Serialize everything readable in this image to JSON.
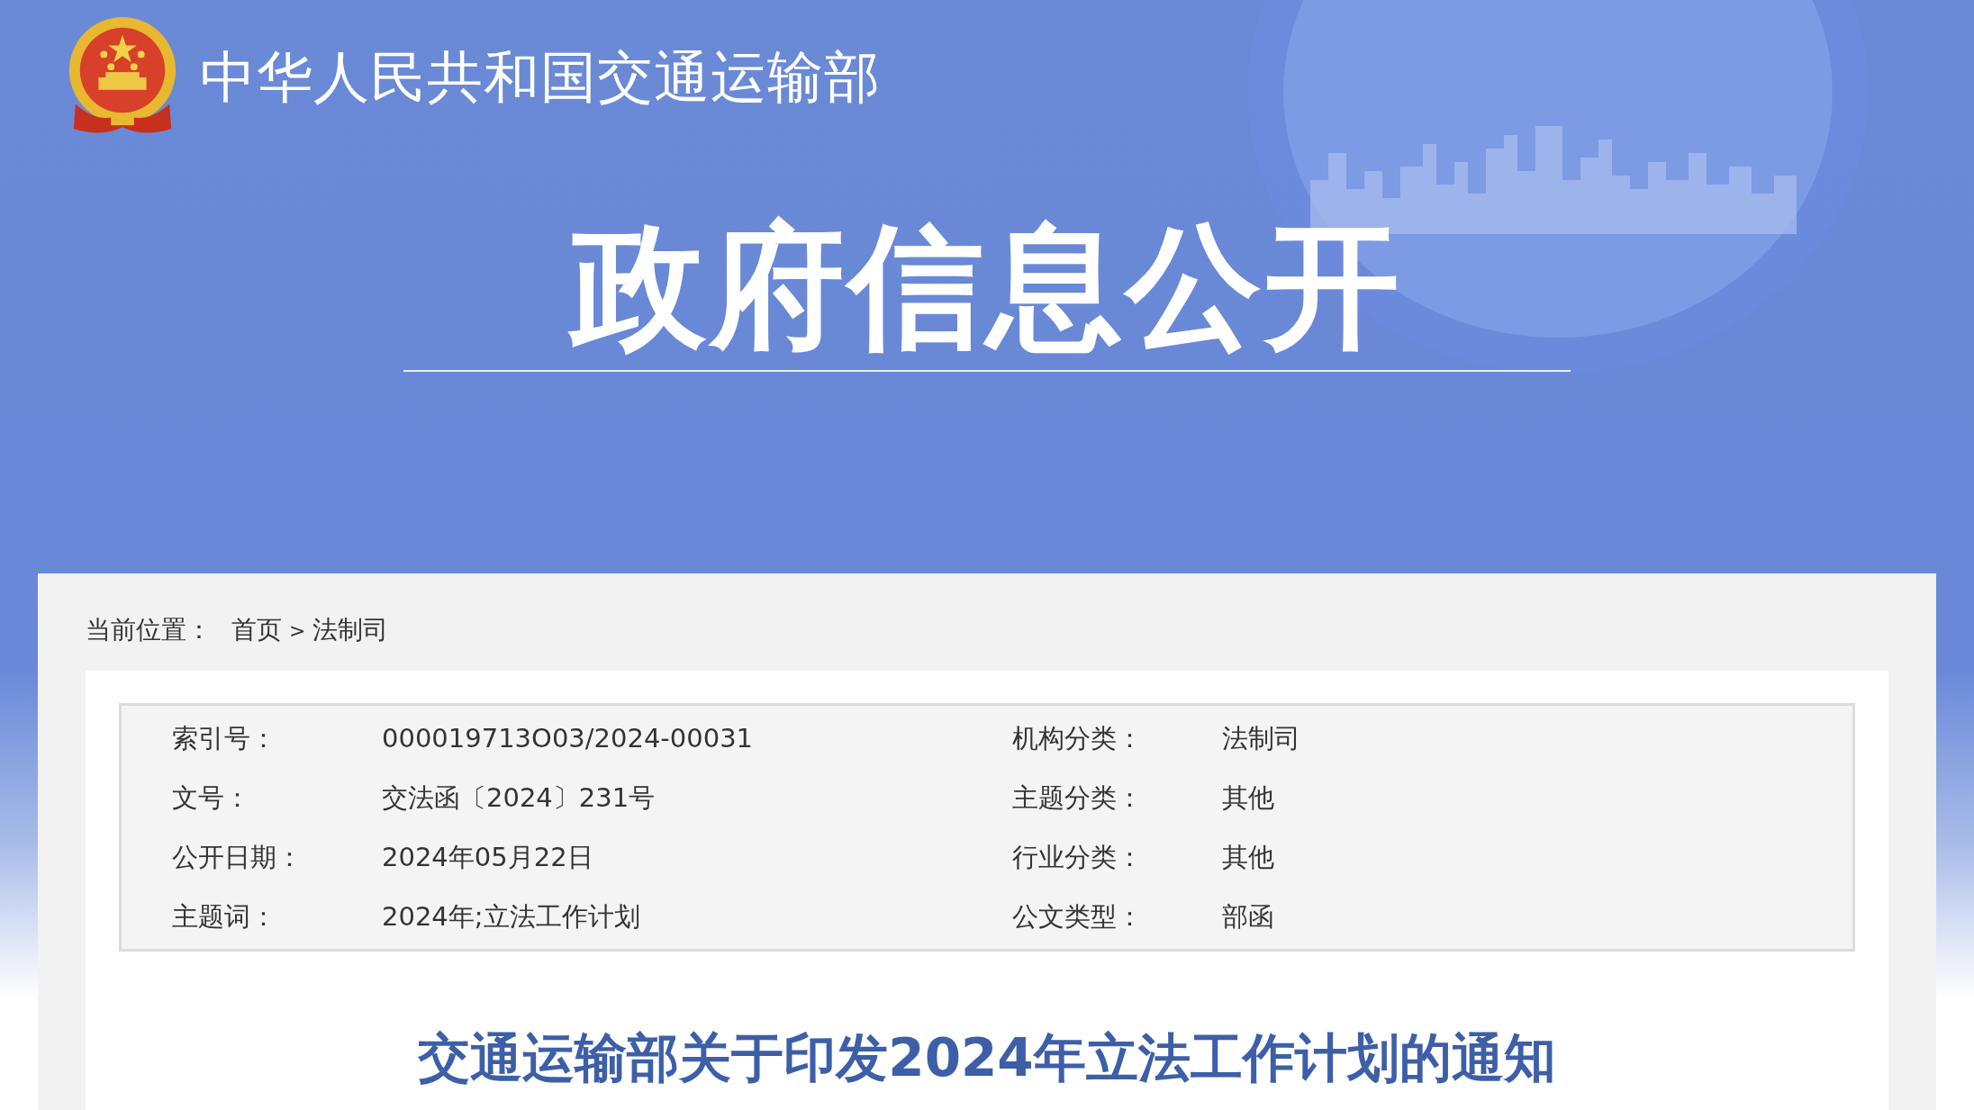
{
  "header": {
    "site_name": "中华人民共和国交通运输部",
    "section_title": "政府信息公开"
  },
  "breadcrumb": {
    "label": "当前位置：",
    "separator": ">",
    "items": [
      {
        "text": "首页"
      },
      {
        "text": "法制司"
      }
    ]
  },
  "meta": [
    {
      "label": "索引号：",
      "value": "000019713O03/2024-00031"
    },
    {
      "label": "机构分类：",
      "value": "法制司"
    },
    {
      "label": "文号：",
      "value": "交法函〔2024〕231号"
    },
    {
      "label": "主题分类：",
      "value": "其他"
    },
    {
      "label": "公开日期：",
      "value": "2024年05月22日"
    },
    {
      "label": "行业分类：",
      "value": "其他"
    },
    {
      "label": "主题词：",
      "value": "2024年;立法工作计划"
    },
    {
      "label": "公文类型：",
      "value": "部函"
    }
  ],
  "article": {
    "title": "交通运输部关于印发2024年立法工作计划的通知"
  }
}
